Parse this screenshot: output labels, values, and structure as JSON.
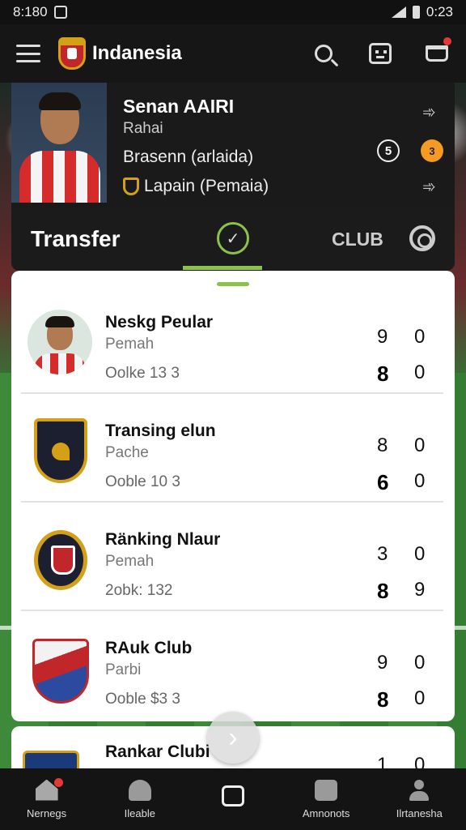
{
  "statusbar": {
    "time_left": "8:180",
    "time_right": "0:23"
  },
  "appbar": {
    "title": "Indanesia",
    "menu_icon": "hamburger-icon",
    "search_icon": "search-icon",
    "face_icon": "face-icon",
    "cart_icon": "cart-icon"
  },
  "player": {
    "name": "Senan AAIRI",
    "sub": "Rahai",
    "club": "Brasenn (arlaida)",
    "position": "Lapain (Pemaia)",
    "badge_left": "5",
    "badge_right": "3"
  },
  "tabs": {
    "active_label": "Transfer",
    "secondary_label": "CLUB"
  },
  "rows": [
    {
      "name": "Neskg Peular",
      "sub": "Pemah",
      "meta": "Oolke 13 3",
      "s1": "9",
      "s2": "0",
      "s3": "8",
      "s4": "0"
    },
    {
      "name": "Transing elun",
      "sub": "Pache",
      "meta": "Ooble 10 3",
      "s1": "8",
      "s2": "0",
      "s3": "6",
      "s4": "0"
    },
    {
      "name": "Ränking Nlaur",
      "sub": "Pemah",
      "meta": "2obk: 132",
      "s1": "3",
      "s2": "0",
      "s3": "8",
      "s4": "9"
    },
    {
      "name": "RAuk Club",
      "sub": "Parbi",
      "meta": "Ooble $3 3",
      "s1": "9",
      "s2": "0",
      "s3": "8",
      "s4": "0"
    }
  ],
  "partial_row": {
    "name": "Rankar Clubi",
    "s1": "1",
    "s2": "0"
  },
  "bottomnav": [
    {
      "label": "Nernegs"
    },
    {
      "label": "Ileable"
    },
    {
      "label": ""
    },
    {
      "label": "Amnonots"
    },
    {
      "label": "Ilrtanesha"
    }
  ]
}
